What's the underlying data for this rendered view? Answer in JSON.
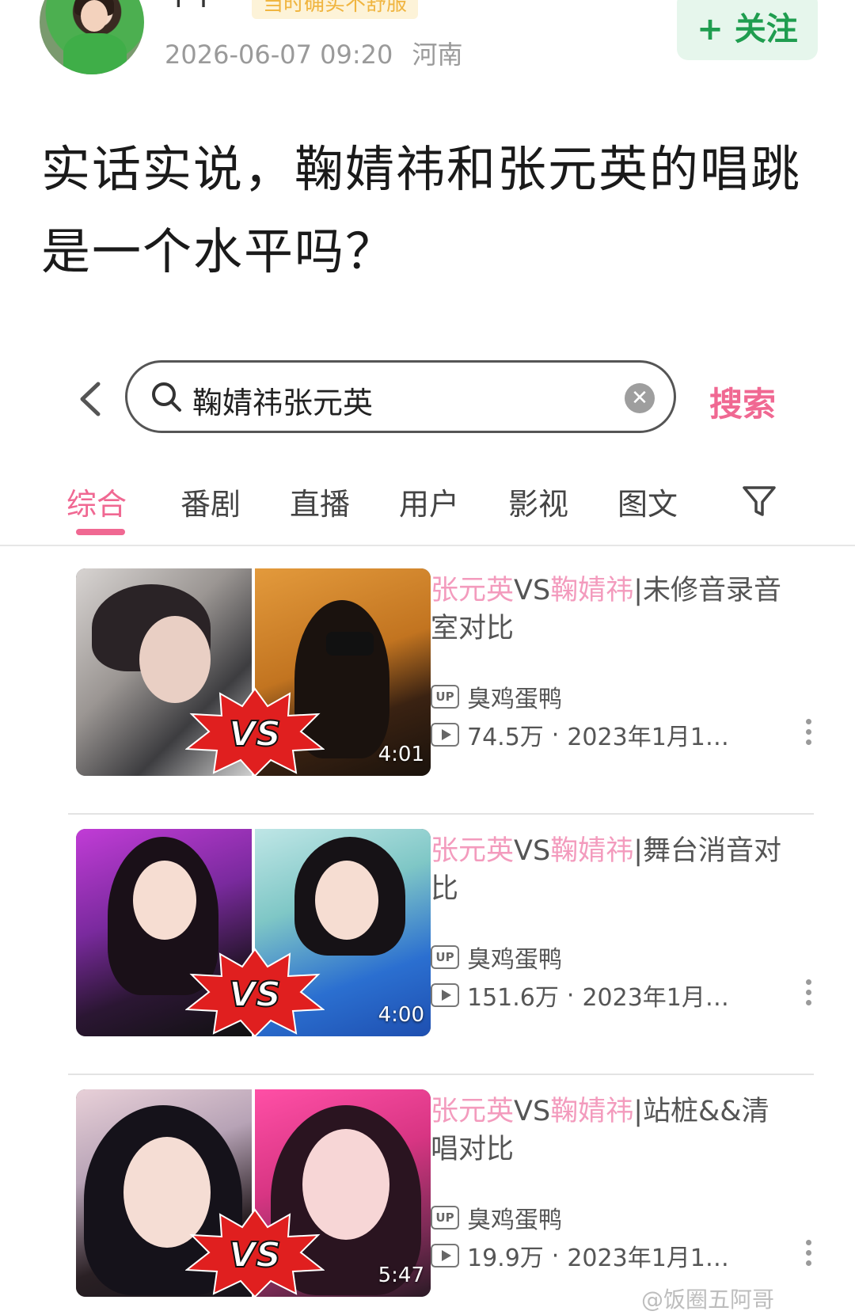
{
  "post": {
    "username": "Y Y",
    "badge": "当时确实不舒服",
    "datetime": "2026-06-07 09:20",
    "location": "河南",
    "follow_label": "+ 关注",
    "title": "实话实说，鞠婧祎和张元英的唱跳是一个水平吗？"
  },
  "search": {
    "query": "鞠婧祎张元英",
    "button_label": "搜索"
  },
  "tabs": [
    {
      "label": "综合",
      "active": true
    },
    {
      "label": "番剧",
      "active": false
    },
    {
      "label": "直播",
      "active": false
    },
    {
      "label": "用户",
      "active": false
    },
    {
      "label": "影视",
      "active": false
    },
    {
      "label": "图文",
      "active": false
    }
  ],
  "results": [
    {
      "title_hl1": "张元英",
      "title_vs": "VS",
      "title_hl2": "鞠婧祎",
      "title_rest": "|未修音录音室对比",
      "duration": "4:01",
      "uploader": "臭鸡蛋鸭",
      "views": "74.5万",
      "date": "2023年1月1…",
      "vs_text": "VS"
    },
    {
      "title_hl1": "张元英",
      "title_vs": "VS",
      "title_hl2": "鞠婧祎",
      "title_rest": "|舞台消音对比",
      "duration": "4:00",
      "uploader": "臭鸡蛋鸭",
      "views": "151.6万",
      "date": "2023年1月…",
      "vs_text": "VS"
    },
    {
      "title_hl1": "张元英",
      "title_vs": "VS",
      "title_hl2": "鞠婧祎",
      "title_rest": "|站桩&&清唱对比",
      "duration": "5:47",
      "uploader": "臭鸡蛋鸭",
      "views": "19.9万",
      "date": "2023年1月1…",
      "vs_text": "VS"
    }
  ],
  "watermark": "@饭圈五阿哥",
  "up_badge": "UP",
  "separator_dot": "·",
  "colors": {
    "accent_pink": "#f06892",
    "highlight_pink": "#f39bbd",
    "follow_green": "#1f9d4f",
    "follow_bg": "#e6f6ec"
  }
}
